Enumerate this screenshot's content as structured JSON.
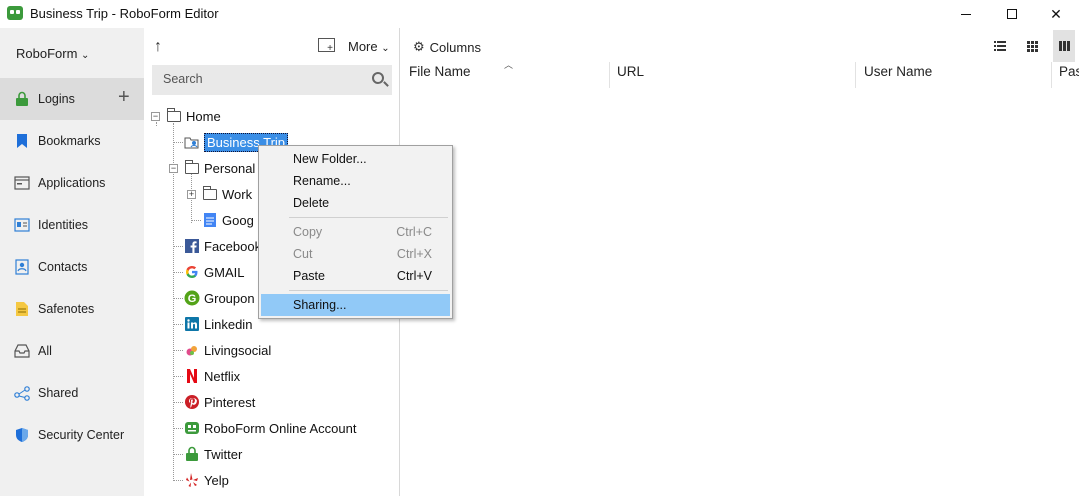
{
  "window": {
    "title": "Business Trip - RoboForm Editor"
  },
  "sidebar": {
    "brand": "RoboForm",
    "items": [
      {
        "label": "Logins",
        "icon": "lock-icon",
        "active": true
      },
      {
        "label": "Bookmarks",
        "icon": "bookmark-icon"
      },
      {
        "label": "Applications",
        "icon": "application-icon"
      },
      {
        "label": "Identities",
        "icon": "identity-card-icon"
      },
      {
        "label": "Contacts",
        "icon": "contact-icon"
      },
      {
        "label": "Safenotes",
        "icon": "note-icon"
      },
      {
        "label": "All",
        "icon": "inbox-icon"
      },
      {
        "label": "Shared",
        "icon": "share-icon"
      },
      {
        "label": "Security Center",
        "icon": "shield-icon"
      }
    ]
  },
  "tree_toolbar": {
    "more_label": "More",
    "search_placeholder": "Search"
  },
  "tree": {
    "home": "Home",
    "business_trip": "Business Trip",
    "personal": "Personal",
    "work": "Work",
    "google": "Goog",
    "facebook": "Facebook",
    "gmail": "GMAIL",
    "groupon": "Groupon",
    "linkedin": "Linkedin",
    "livingsocial": "Livingsocial",
    "netflix": "Netflix",
    "pinterest": "Pinterest",
    "roboform": "RoboForm Online Account",
    "twitter": "Twitter",
    "yelp": "Yelp"
  },
  "main": {
    "columns_label": "Columns",
    "headers": [
      "File Name",
      "URL",
      "User Name",
      "Pas"
    ]
  },
  "context_menu": {
    "new_folder": "New Folder...",
    "rename": "Rename...",
    "delete": "Delete",
    "copy": "Copy",
    "copy_shortcut": "Ctrl+C",
    "cut": "Cut",
    "cut_shortcut": "Ctrl+X",
    "paste": "Paste",
    "paste_shortcut": "Ctrl+V",
    "sharing": "Sharing..."
  },
  "colors": {
    "selection": "#3a8ee6",
    "menu_hover": "#91c9f7",
    "brand_green": "#3c9a3c"
  }
}
